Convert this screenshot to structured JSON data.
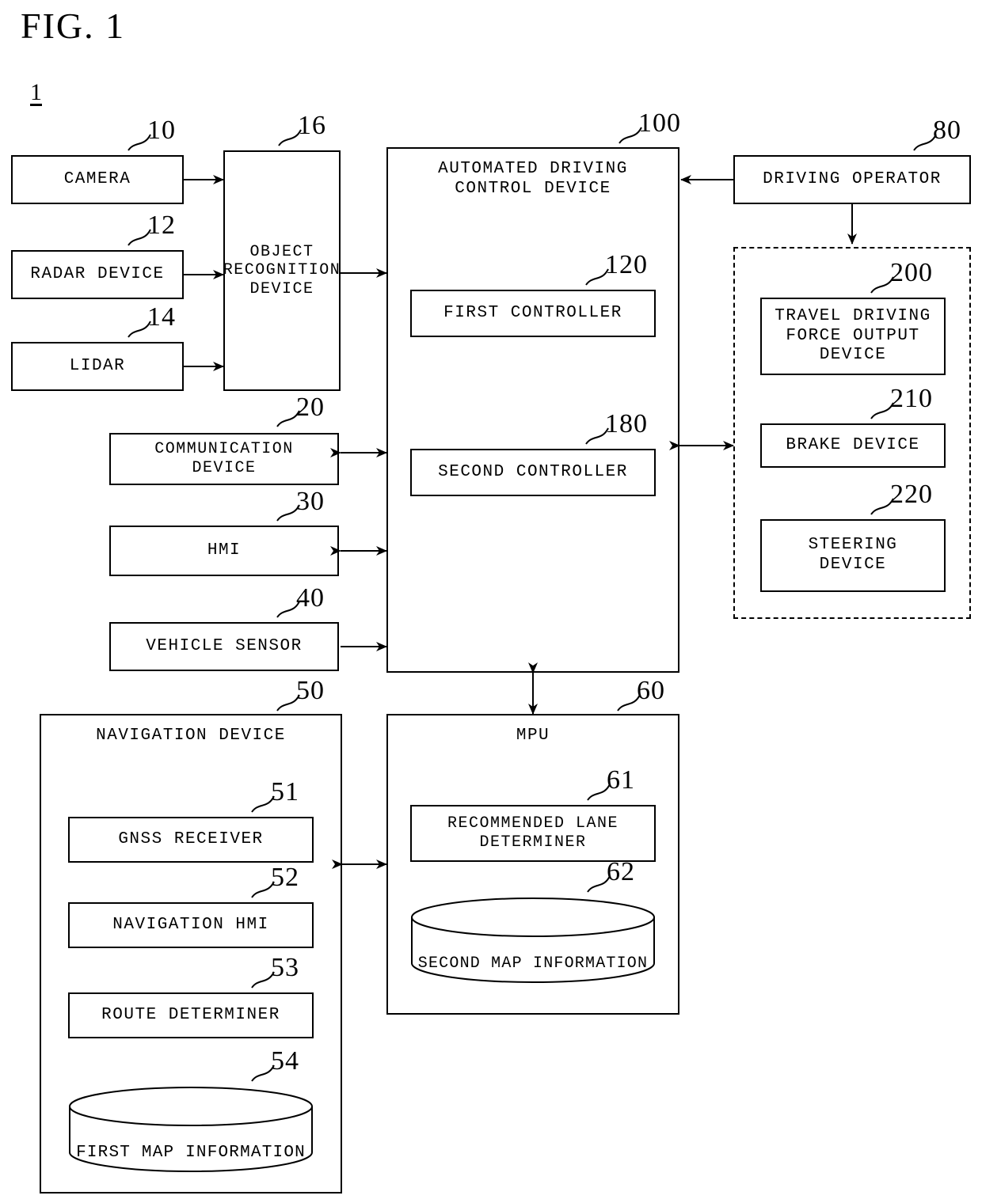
{
  "figure": {
    "title": "FIG. 1",
    "system_ref": "1"
  },
  "blocks": {
    "camera": {
      "label": "CAMERA",
      "ref": "10"
    },
    "radar": {
      "label": "RADAR DEVICE",
      "ref": "12"
    },
    "lidar": {
      "label": "LIDAR",
      "ref": "14"
    },
    "object_recognition": {
      "label": "OBJECT\nRECOGNITION\nDEVICE",
      "ref": "16"
    },
    "communication": {
      "label": "COMMUNICATION\nDEVICE",
      "ref": "20"
    },
    "hmi": {
      "label": "HMI",
      "ref": "30"
    },
    "vehicle_sensor": {
      "label": "VEHICLE SENSOR",
      "ref": "40"
    },
    "automated_driving": {
      "label": "AUTOMATED DRIVING\nCONTROL DEVICE",
      "ref": "100"
    },
    "first_controller": {
      "label": "FIRST CONTROLLER",
      "ref": "120"
    },
    "second_controller": {
      "label": "SECOND CONTROLLER",
      "ref": "180"
    },
    "driving_operator": {
      "label": "DRIVING OPERATOR",
      "ref": "80"
    },
    "travel_driving_force": {
      "label": "TRAVEL DRIVING\nFORCE OUTPUT\nDEVICE",
      "ref": "200"
    },
    "brake_device": {
      "label": "BRAKE DEVICE",
      "ref": "210"
    },
    "steering_device": {
      "label": "STEERING\nDEVICE",
      "ref": "220"
    },
    "navigation_device": {
      "label": "NAVIGATION DEVICE",
      "ref": "50"
    },
    "gnss_receiver": {
      "label": "GNSS RECEIVER",
      "ref": "51"
    },
    "navigation_hmi": {
      "label": "NAVIGATION HMI",
      "ref": "52"
    },
    "route_determiner": {
      "label": "ROUTE DETERMINER",
      "ref": "53"
    },
    "first_map_information": {
      "label": "FIRST MAP INFORMATION",
      "ref": "54"
    },
    "mpu": {
      "label": "MPU",
      "ref": "60"
    },
    "recommended_lane": {
      "label": "RECOMMENDED LANE\nDETERMINER",
      "ref": "61"
    },
    "second_map_information": {
      "label": "SECOND MAP INFORMATION",
      "ref": "62"
    }
  },
  "connections": [
    {
      "name": "camera-to-object-recognition",
      "type": "arrow-right"
    },
    {
      "name": "radar-to-object-recognition",
      "type": "arrow-right"
    },
    {
      "name": "lidar-to-object-recognition",
      "type": "arrow-right"
    },
    {
      "name": "object-recognition-to-control-device",
      "type": "arrow-right"
    },
    {
      "name": "communication-to-control-device",
      "type": "arrow-both"
    },
    {
      "name": "hmi-to-control-device",
      "type": "arrow-both"
    },
    {
      "name": "vehicle-sensor-to-control-device",
      "type": "arrow-right"
    },
    {
      "name": "driving-operator-to-control-device",
      "type": "arrow-left"
    },
    {
      "name": "driving-operator-to-actuators",
      "type": "arrow-down"
    },
    {
      "name": "control-device-to-actuators",
      "type": "arrow-both"
    },
    {
      "name": "control-device-to-mpu",
      "type": "arrow-both-vertical"
    },
    {
      "name": "navigation-device-to-mpu",
      "type": "arrow-both"
    }
  ],
  "colors": {
    "line": "#000000",
    "background": "#ffffff"
  }
}
